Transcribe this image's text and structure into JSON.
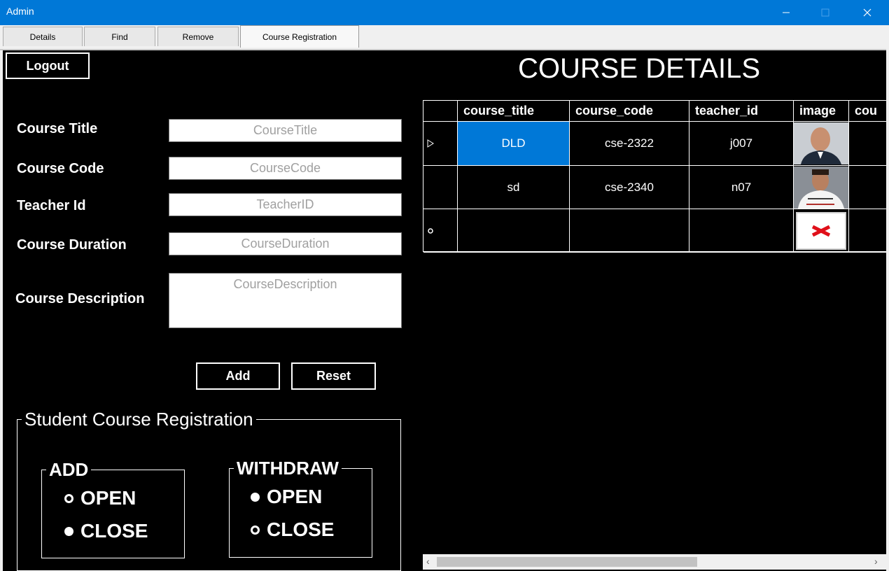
{
  "window": {
    "title": "Admin"
  },
  "tabs": [
    {
      "label": "Details"
    },
    {
      "label": "Find"
    },
    {
      "label": "Remove"
    },
    {
      "label": "Course Registration",
      "active": true
    }
  ],
  "logout_label": "Logout",
  "form": {
    "title_label": "Course Title",
    "title_placeholder": "CourseTitle",
    "code_label": "Course Code",
    "code_placeholder": "CourseCode",
    "teacher_label": "Teacher Id",
    "teacher_placeholder": "TeacherID",
    "duration_label": "Course Duration",
    "duration_placeholder": "CourseDuration",
    "description_label": "Course Description",
    "description_placeholder": "CourseDescription",
    "add_label": "Add",
    "reset_label": "Reset"
  },
  "registration": {
    "group_label": "Student Course Registration",
    "add": {
      "label": "ADD",
      "open": "OPEN",
      "close": "CLOSE",
      "selected": "CLOSE"
    },
    "withdraw": {
      "label": "WITHDRAW",
      "open": "OPEN",
      "close": "CLOSE",
      "selected": "OPEN"
    }
  },
  "course_details": {
    "heading": "COURSE DETAILS",
    "columns": [
      "course_title",
      "course_code",
      "teacher_id",
      "image",
      "cou"
    ],
    "rows": [
      {
        "course_title": "DLD",
        "course_code": "cse-2322",
        "teacher_id": "j007",
        "image": "teacher-photo",
        "selected": true
      },
      {
        "course_title": "sd",
        "course_code": "cse-2340",
        "teacher_id": "n07",
        "image": "teacher-photo",
        "selected": false
      },
      {
        "course_title": "",
        "course_code": "",
        "teacher_id": "",
        "image": "missing-image",
        "new_row": true
      }
    ]
  },
  "icons": {
    "row_indicator": "triangle-right-icon",
    "new_row": "asterisk-icon",
    "missing_image": "red-x-icon"
  },
  "colors": {
    "titlebar": "#0078d7",
    "selection": "#0078d7",
    "panel": "#000000"
  }
}
